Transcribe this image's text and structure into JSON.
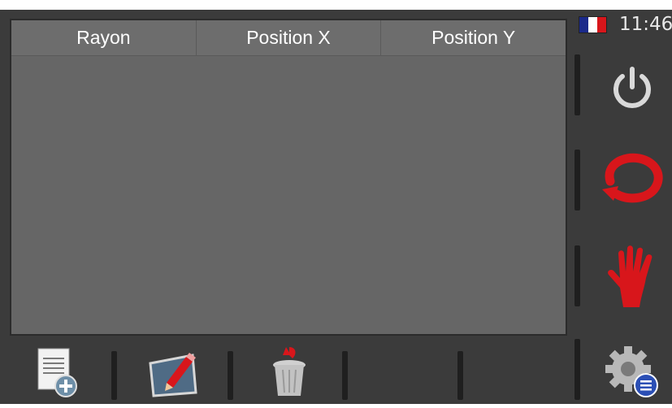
{
  "table": {
    "columns": [
      "Rayon",
      "Position X",
      "Position Y"
    ],
    "rows": []
  },
  "status": {
    "time": "11:46",
    "language_flag": "french-flag-icon"
  },
  "side_buttons": [
    {
      "name": "power-button",
      "icon": "power-icon"
    },
    {
      "name": "refresh-button",
      "icon": "circular-arrow-icon"
    },
    {
      "name": "stop-button",
      "icon": "red-hand-icon"
    },
    {
      "name": "settings-button",
      "icon": "gear-list-icon"
    }
  ],
  "bottom_buttons": [
    {
      "name": "add-document-button",
      "icon": "document-add-icon"
    },
    {
      "name": "edit-button",
      "icon": "pencil-edit-icon"
    },
    {
      "name": "delete-button",
      "icon": "trash-bin-icon"
    }
  ],
  "colors": {
    "background": "#3b3b3b",
    "table": "#666666",
    "accent_red": "#d8161b"
  }
}
